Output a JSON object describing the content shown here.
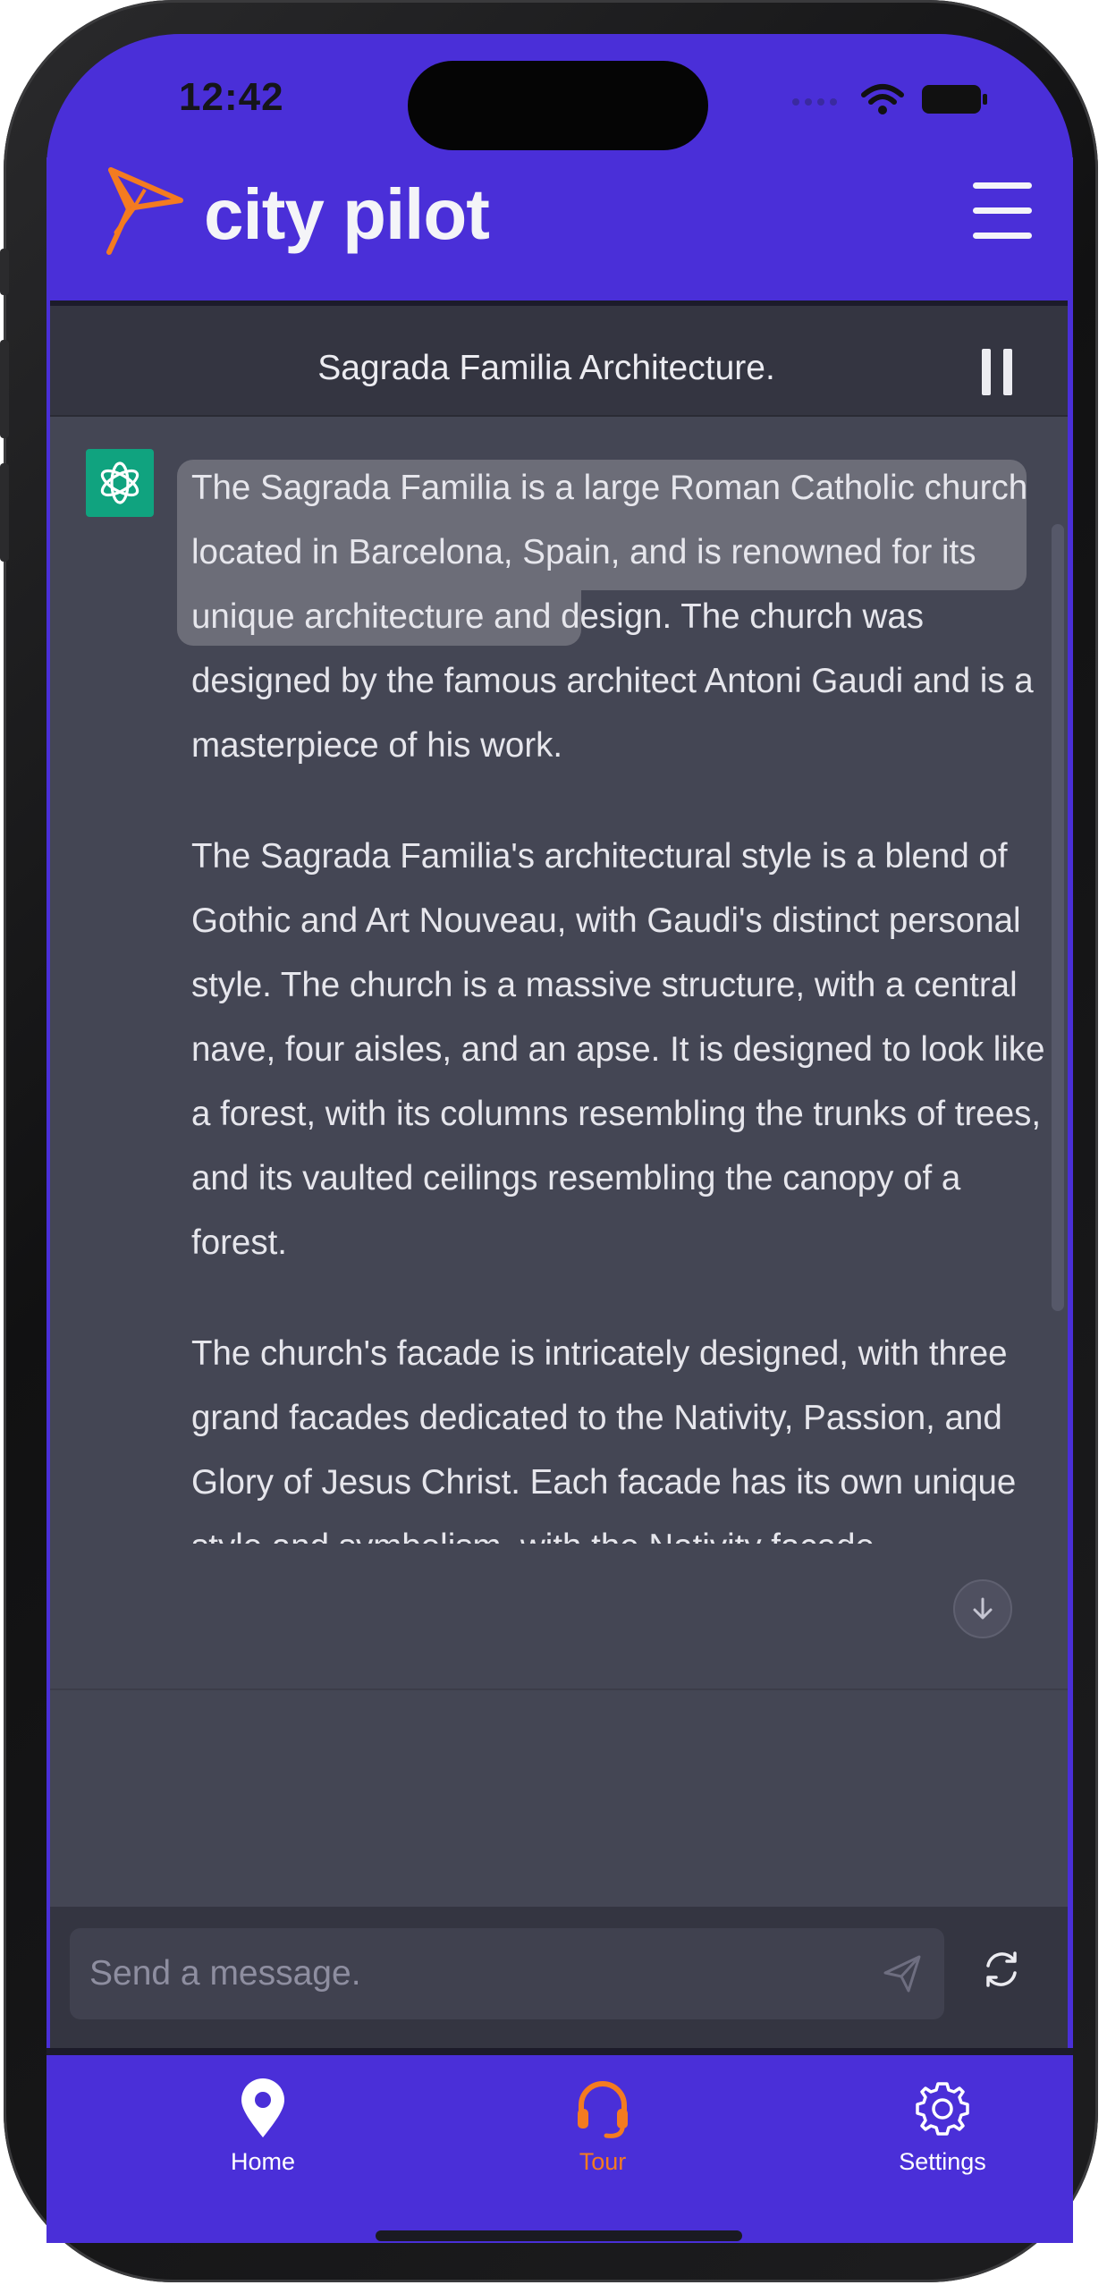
{
  "status_bar": {
    "time": "12:42",
    "icons": [
      "signal-icon",
      "wifi-icon",
      "battery-icon"
    ]
  },
  "app": {
    "brand": "city pilot",
    "logo": "city-pilot-logo",
    "menu_icon": "hamburger-menu-icon"
  },
  "chat": {
    "title": "Sagrada Familia Architecture.",
    "pause_icon": "pause-icon",
    "assistant_icon": "openai-logo-icon",
    "paragraphs": [
      "The Sagrada Familia is a large Roman Catholic church located in Barcelona, Spain, and is renowned for its unique architecture and design. The church was designed by the famous architect Antoni Gaudi and is a masterpiece of his work.",
      "The Sagrada Familia's architectural style is a blend of Gothic and Art Nouveau, with Gaudi's distinct personal style. The church is a massive structure, with a central nave, four aisles, and an apse. It is designed to look like a forest, with its columns resembling the trunks of trees, and its vaulted ceilings resembling the canopy of a forest.",
      "The church's facade is intricately designed, with three grand facades dedicated to the Nativity, Passion, and Glory of Jesus Christ. Each facade has its own unique style and symbolism, with the Nativity facade showcasing scenes from the birth"
    ],
    "scroll_down_icon": "arrow-down-icon"
  },
  "composer": {
    "placeholder": "Send a message.",
    "send_icon": "send-icon",
    "regenerate_icon": "refresh-icon"
  },
  "nav": {
    "items": [
      {
        "label": "Home",
        "icon": "map-pin-icon",
        "active": false
      },
      {
        "label": "Tour",
        "icon": "headset-icon",
        "active": true
      },
      {
        "label": "Settings",
        "icon": "gear-icon",
        "active": false
      }
    ]
  },
  "colors": {
    "brand": "#4a2fd8",
    "accent": "#f47b20",
    "chat_bg": "#444654",
    "header_bg": "#343541",
    "assistant_avatar": "#10a37f"
  }
}
